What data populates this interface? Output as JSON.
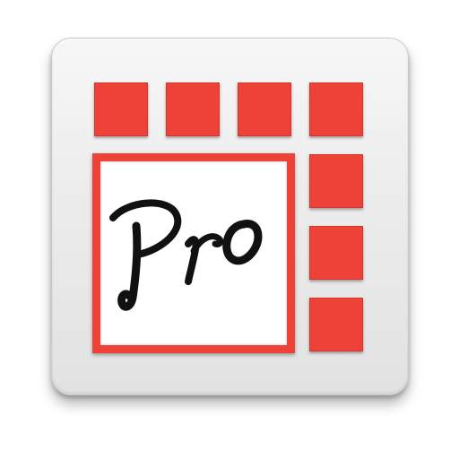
{
  "app_icon": {
    "logo_text": "Pro",
    "colors": {
      "accent_red": "#ee4138",
      "tile_background": "#ececec",
      "frame_inner": "#ffffff",
      "logo_ink": "#111111"
    },
    "grid": {
      "top_row_squares": 4,
      "right_column_squares": 3
    }
  }
}
